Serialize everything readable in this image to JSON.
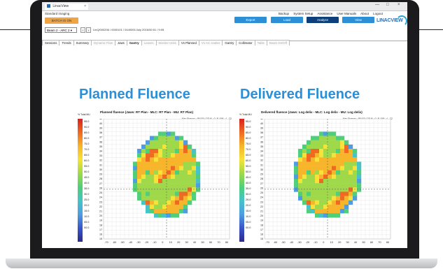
{
  "browser": {
    "tab_title": "LinacView",
    "tab_close": "×",
    "minimize": "—",
    "maximize": "□",
    "close": "×"
  },
  "app": {
    "section": "Standard imaging",
    "batch_button": "BATCH IS ON",
    "menu": [
      "Backup",
      "System Setup",
      "Assistance",
      "User Manuals",
      "About",
      "Logout"
    ],
    "actions": [
      {
        "label": "Export",
        "color": "#2d8fd5"
      },
      {
        "label": "Load",
        "color": "#2d8fd5"
      },
      {
        "label": "Analyze",
        "color": "#0d3f7a"
      },
      {
        "label": "View",
        "color": "#2d8fd5"
      }
    ],
    "logo_text": "LINACVIEW",
    "exam_selector": "Beam 2 - ARC 2 ▾",
    "nav_prev": "‹",
    "nav_next": "›",
    "exam_path": "LinQ/000206 / 0000101 / 0449391/July 2016/00:51 / 9:05",
    "tabs": [
      {
        "label": "Sessions",
        "state": "normal"
      },
      {
        "label": "Trends",
        "state": "normal"
      },
      {
        "label": "Summary",
        "state": "normal"
      },
      {
        "label": "Dynamic Flow",
        "state": "dim"
      },
      {
        "label": "Jaws",
        "state": "normal"
      },
      {
        "label": "Gantry",
        "state": "active"
      },
      {
        "label": "Leaves",
        "state": "dim"
      },
      {
        "label": "Monitor Units",
        "state": "dim"
      },
      {
        "label": "Vs Planned",
        "state": "normal"
      },
      {
        "label": "Vs Arc scatter",
        "state": "dim"
      },
      {
        "label": "Gantry",
        "state": "normal"
      },
      {
        "label": "Collimator",
        "state": "normal"
      },
      {
        "label": "Table",
        "state": "dim"
      },
      {
        "label": "Beam On/Off",
        "state": "dim"
      }
    ]
  },
  "panels": [
    {
      "heading": "Planned Fluence",
      "plot_title": "Planned fluence (Jaws: RT Plan - MLC: RT Plan - MU: RT Plan)",
      "subtitle": "Max Fluence = 88,000 / GF NL: 0 / B / Pt/L: 4 - C2",
      "colorbar_label": "% Total MU",
      "seed": 1
    },
    {
      "heading": "Delivered Fluence",
      "plot_title": "Delivered fluence (Jaws: Log delix - MLC: Log delix - MU: Log delix)",
      "subtitle": "Max Fluence = 88,000 / GF NL: 0 / B / Pt/L: 4 - C2",
      "colorbar_label": "% Total MU",
      "seed": 2
    }
  ],
  "colorbar_ticks": [
    "95.0",
    "90.0",
    "85.0",
    "80.0",
    "75.0",
    "70.0",
    "65.0",
    "60.0",
    "55.0",
    "50.0",
    "45.0",
    "40.0",
    "35.0",
    "30.0",
    "25.0",
    "20.0",
    "15.0",
    "10.0",
    "05.0",
    "00.0"
  ],
  "y_ticks": [
    "42",
    "40",
    "39",
    "38",
    "37",
    "36",
    "35",
    "34",
    "33",
    "32",
    "31",
    "30",
    "29",
    "28",
    "27",
    "26",
    "25",
    "24",
    "23",
    "22",
    "21",
    "20",
    "19",
    "18",
    "17",
    "16",
    "15"
  ],
  "x_ticks": [
    "-70",
    "-60",
    "-50",
    "-40",
    "-30",
    "-20",
    "-10",
    "0",
    "10",
    "20",
    "30",
    "40",
    "50",
    "60",
    "70",
    "80"
  ],
  "colors": {
    "accent": "#2c8fd6",
    "batch": "#f0a443",
    "colormap": [
      "#2a2a8a",
      "#3a55c9",
      "#4e9de0",
      "#46c3c8",
      "#4fcf7a",
      "#9fd94a",
      "#f5e33a",
      "#f6b52b",
      "#ee6a23",
      "#d8231d"
    ]
  }
}
